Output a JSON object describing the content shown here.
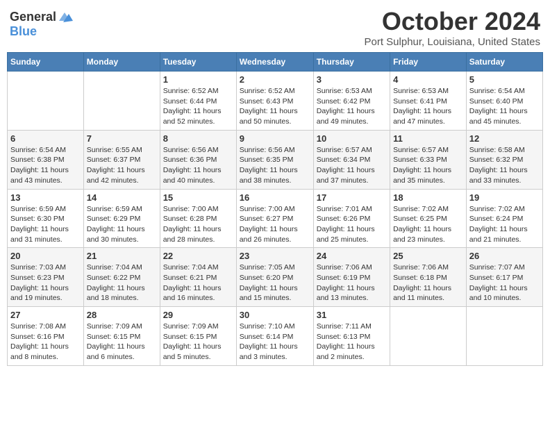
{
  "header": {
    "logo_general": "General",
    "logo_blue": "Blue",
    "title": "October 2024",
    "location": "Port Sulphur, Louisiana, United States"
  },
  "weekdays": [
    "Sunday",
    "Monday",
    "Tuesday",
    "Wednesday",
    "Thursday",
    "Friday",
    "Saturday"
  ],
  "weeks": [
    [
      null,
      null,
      {
        "day": 1,
        "sunrise": "6:52 AM",
        "sunset": "6:44 PM",
        "daylight": "11 hours and 52 minutes."
      },
      {
        "day": 2,
        "sunrise": "6:52 AM",
        "sunset": "6:43 PM",
        "daylight": "11 hours and 50 minutes."
      },
      {
        "day": 3,
        "sunrise": "6:53 AM",
        "sunset": "6:42 PM",
        "daylight": "11 hours and 49 minutes."
      },
      {
        "day": 4,
        "sunrise": "6:53 AM",
        "sunset": "6:41 PM",
        "daylight": "11 hours and 47 minutes."
      },
      {
        "day": 5,
        "sunrise": "6:54 AM",
        "sunset": "6:40 PM",
        "daylight": "11 hours and 45 minutes."
      }
    ],
    [
      {
        "day": 6,
        "sunrise": "6:54 AM",
        "sunset": "6:38 PM",
        "daylight": "11 hours and 43 minutes."
      },
      {
        "day": 7,
        "sunrise": "6:55 AM",
        "sunset": "6:37 PM",
        "daylight": "11 hours and 42 minutes."
      },
      {
        "day": 8,
        "sunrise": "6:56 AM",
        "sunset": "6:36 PM",
        "daylight": "11 hours and 40 minutes."
      },
      {
        "day": 9,
        "sunrise": "6:56 AM",
        "sunset": "6:35 PM",
        "daylight": "11 hours and 38 minutes."
      },
      {
        "day": 10,
        "sunrise": "6:57 AM",
        "sunset": "6:34 PM",
        "daylight": "11 hours and 37 minutes."
      },
      {
        "day": 11,
        "sunrise": "6:57 AM",
        "sunset": "6:33 PM",
        "daylight": "11 hours and 35 minutes."
      },
      {
        "day": 12,
        "sunrise": "6:58 AM",
        "sunset": "6:32 PM",
        "daylight": "11 hours and 33 minutes."
      }
    ],
    [
      {
        "day": 13,
        "sunrise": "6:59 AM",
        "sunset": "6:30 PM",
        "daylight": "11 hours and 31 minutes."
      },
      {
        "day": 14,
        "sunrise": "6:59 AM",
        "sunset": "6:29 PM",
        "daylight": "11 hours and 30 minutes."
      },
      {
        "day": 15,
        "sunrise": "7:00 AM",
        "sunset": "6:28 PM",
        "daylight": "11 hours and 28 minutes."
      },
      {
        "day": 16,
        "sunrise": "7:00 AM",
        "sunset": "6:27 PM",
        "daylight": "11 hours and 26 minutes."
      },
      {
        "day": 17,
        "sunrise": "7:01 AM",
        "sunset": "6:26 PM",
        "daylight": "11 hours and 25 minutes."
      },
      {
        "day": 18,
        "sunrise": "7:02 AM",
        "sunset": "6:25 PM",
        "daylight": "11 hours and 23 minutes."
      },
      {
        "day": 19,
        "sunrise": "7:02 AM",
        "sunset": "6:24 PM",
        "daylight": "11 hours and 21 minutes."
      }
    ],
    [
      {
        "day": 20,
        "sunrise": "7:03 AM",
        "sunset": "6:23 PM",
        "daylight": "11 hours and 19 minutes."
      },
      {
        "day": 21,
        "sunrise": "7:04 AM",
        "sunset": "6:22 PM",
        "daylight": "11 hours and 18 minutes."
      },
      {
        "day": 22,
        "sunrise": "7:04 AM",
        "sunset": "6:21 PM",
        "daylight": "11 hours and 16 minutes."
      },
      {
        "day": 23,
        "sunrise": "7:05 AM",
        "sunset": "6:20 PM",
        "daylight": "11 hours and 15 minutes."
      },
      {
        "day": 24,
        "sunrise": "7:06 AM",
        "sunset": "6:19 PM",
        "daylight": "11 hours and 13 minutes."
      },
      {
        "day": 25,
        "sunrise": "7:06 AM",
        "sunset": "6:18 PM",
        "daylight": "11 hours and 11 minutes."
      },
      {
        "day": 26,
        "sunrise": "7:07 AM",
        "sunset": "6:17 PM",
        "daylight": "11 hours and 10 minutes."
      }
    ],
    [
      {
        "day": 27,
        "sunrise": "7:08 AM",
        "sunset": "6:16 PM",
        "daylight": "11 hours and 8 minutes."
      },
      {
        "day": 28,
        "sunrise": "7:09 AM",
        "sunset": "6:15 PM",
        "daylight": "11 hours and 6 minutes."
      },
      {
        "day": 29,
        "sunrise": "7:09 AM",
        "sunset": "6:15 PM",
        "daylight": "11 hours and 5 minutes."
      },
      {
        "day": 30,
        "sunrise": "7:10 AM",
        "sunset": "6:14 PM",
        "daylight": "11 hours and 3 minutes."
      },
      {
        "day": 31,
        "sunrise": "7:11 AM",
        "sunset": "6:13 PM",
        "daylight": "11 hours and 2 minutes."
      },
      null,
      null
    ]
  ],
  "labels": {
    "sunrise_prefix": "Sunrise: ",
    "sunset_prefix": "Sunset: ",
    "daylight_prefix": "Daylight: "
  }
}
